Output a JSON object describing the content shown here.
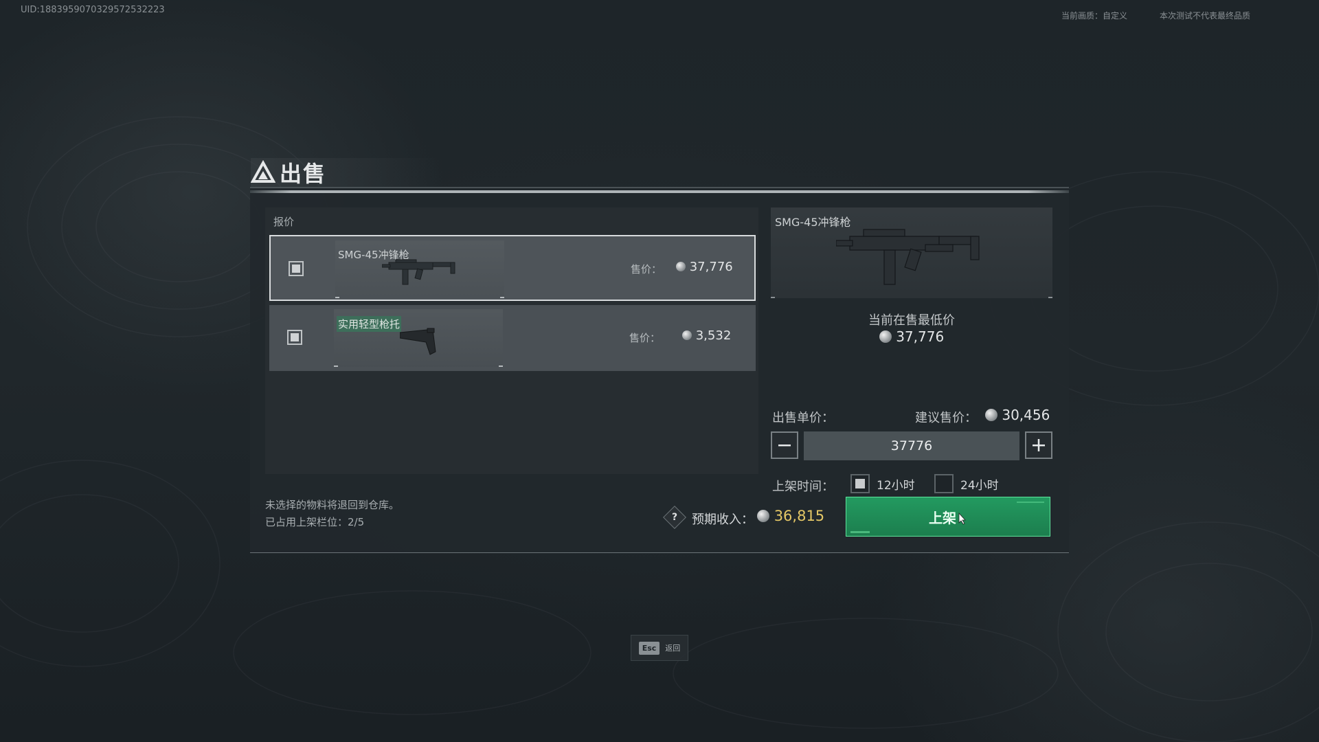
{
  "header": {
    "uid": "UID:1883959070329572532223",
    "quality_label": "当前画质：自定义",
    "test_notice": "本次测试不代表最终品质"
  },
  "dialog": {
    "title": "出售",
    "quote_label": "报价",
    "items": [
      {
        "name": "SMG-45冲锋枪",
        "price_label": "售价：",
        "price": "37,776",
        "selected": true,
        "icon": "smg-icon"
      },
      {
        "name": "实用轻型枪托",
        "price_label": "售价：",
        "price": "3,532",
        "selected": false,
        "icon": "stock-icon"
      }
    ],
    "preview": {
      "name": "SMG-45冲锋枪",
      "icon": "smg-icon",
      "lowest_label": "当前在售最低价",
      "lowest_price": "37,776"
    },
    "pricing": {
      "unit_label": "出售单价：",
      "suggest_label": "建议售价：",
      "suggest_price": "30,456",
      "current_value": "37776"
    },
    "duration": {
      "label": "上架时间：",
      "options": [
        {
          "label": "12小时",
          "selected": true
        },
        {
          "label": "24小时",
          "selected": false
        }
      ]
    },
    "footer": {
      "info_unselected": "未选择的物料将退回到仓库。",
      "info_slots": "已占用上架栏位：2/5",
      "income_label": "预期收入：",
      "income_value": "36,815",
      "list_button": "上架"
    }
  },
  "esc_hint": {
    "key": "Esc",
    "label": "返回"
  },
  "colors": {
    "accent_green": "#239a60",
    "income_gold": "#e4c766"
  }
}
